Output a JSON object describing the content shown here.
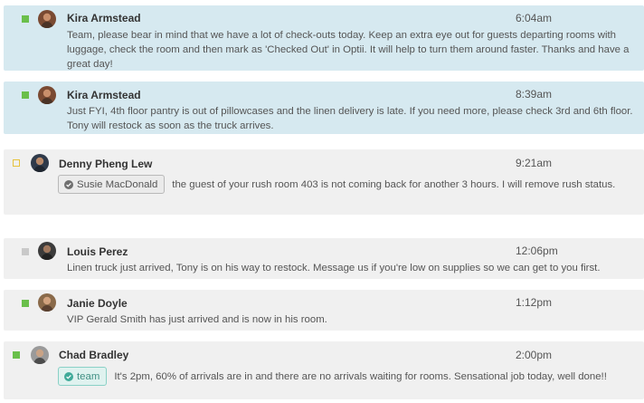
{
  "messages": [
    {
      "author": "Kira Armstead",
      "time": "6:04am",
      "status": "green",
      "body_lines": [
        "Team, please bear in mind that we have a lot of check-outs today. Keep an extra eye out for guests departing rooms with",
        "luggage, check the room and then mark as 'Checked Out' in Optii. It will help to turn them around faster. Thanks and have a",
        "great day!"
      ]
    },
    {
      "author": "Kira Armstead",
      "time": "8:39am",
      "status": "green",
      "body_lines": [
        "Just FYI, 4th floor pantry is out of pillowcases and the linen delivery is late. If you need more, please check 3rd and 6th floor.",
        "Tony will restock as soon as the truck arrives."
      ]
    },
    {
      "author": "Denny Pheng Lew",
      "time": "9:21am",
      "status": "yellow-outline",
      "chip": "Susie MacDonald",
      "body": "the guest of your rush room 403 is not coming back for another 3 hours. I will remove rush status."
    },
    {
      "author": "Louis Perez",
      "time": "12:06pm",
      "status": "grey",
      "body": "Linen truck just arrived, Tony is on his way to restock. Message us if you're low on supplies so we can get to you first."
    },
    {
      "author": "Janie Doyle",
      "time": "1:12pm",
      "status": "green",
      "body": "VIP Gerald Smith has just arrived and is now in his room."
    },
    {
      "author": "Chad Bradley",
      "time": "2:00pm",
      "status": "green",
      "chip": "team",
      "body": "It's 2pm, 60% of arrivals are in and there are no arrivals waiting for rooms. Sensational job today, well done!!"
    }
  ],
  "colors": {
    "highlight_bg": "#d6e9f0",
    "plain_bg": "#f0f0f0",
    "status_green": "#6abf4b",
    "status_grey": "#c9c9c9",
    "status_yellow": "#e6c23c",
    "team_chip_text": "#3f8f83"
  },
  "icons": {
    "person_chip": "check-circle-icon",
    "team_chip": "check-circle-icon"
  }
}
